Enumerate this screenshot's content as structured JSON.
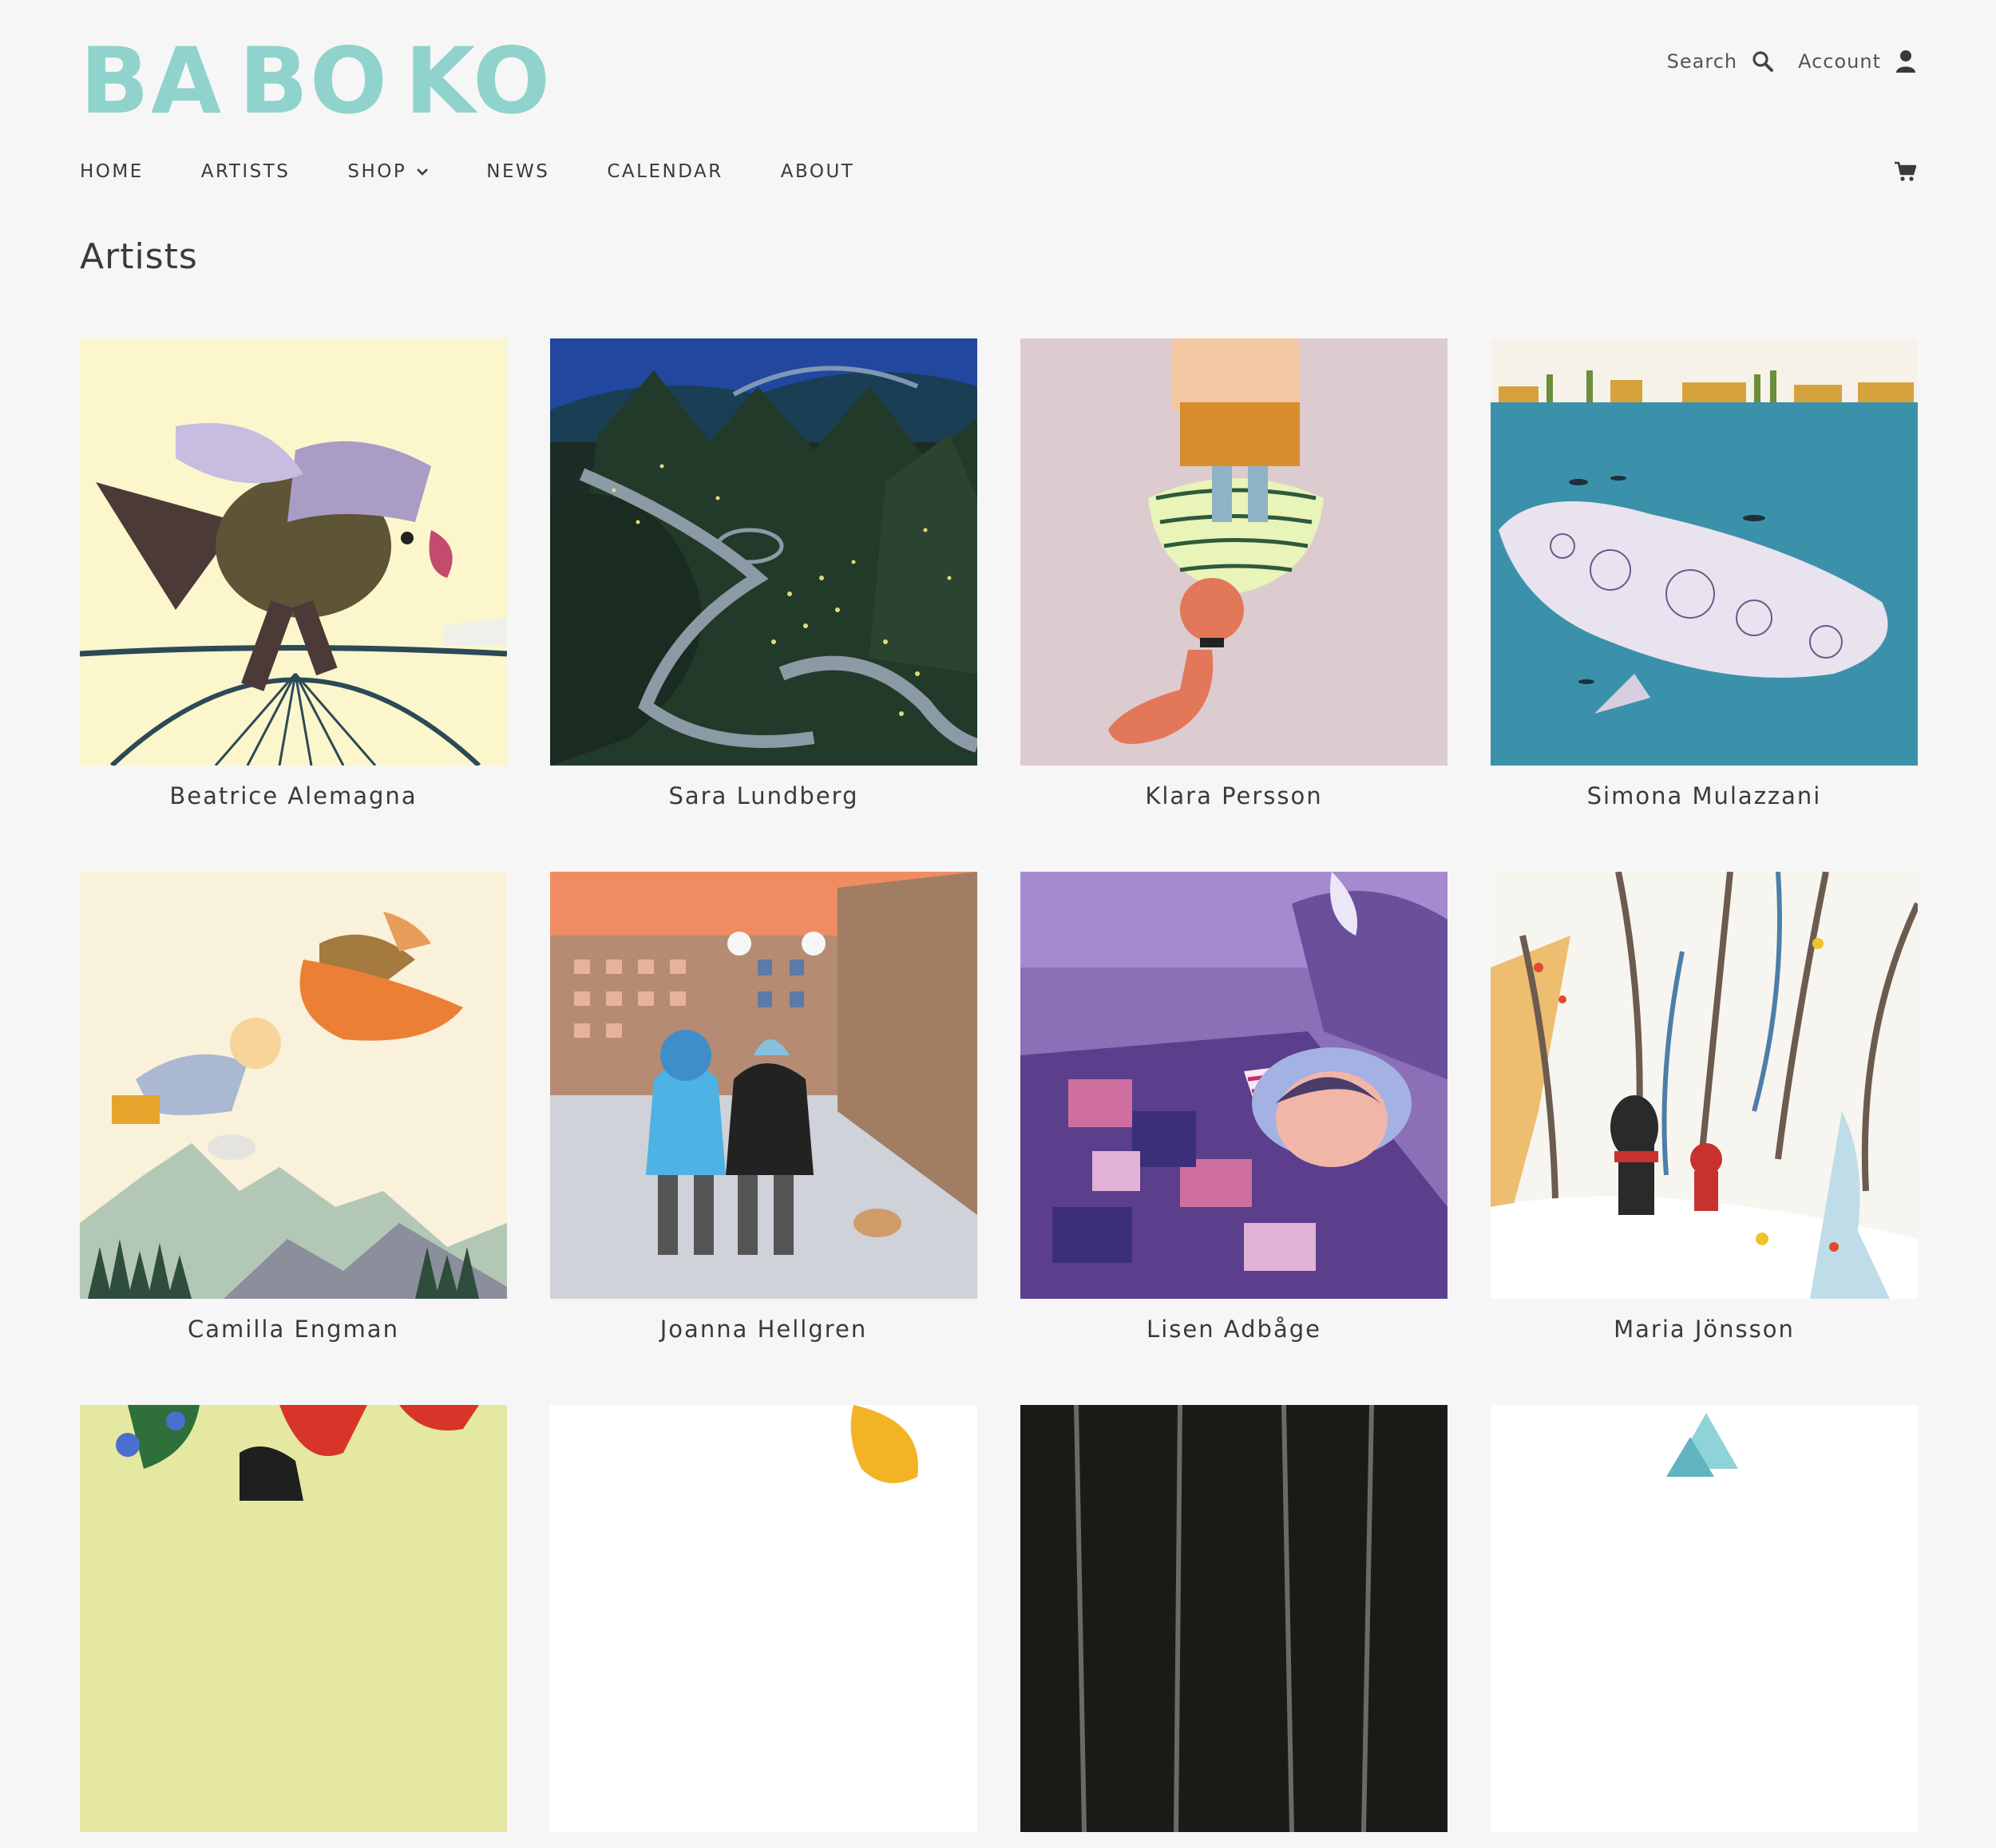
{
  "brand": {
    "logo_parts": [
      "BA",
      "BO",
      "KO"
    ],
    "color": "#8fd3cc"
  },
  "header": {
    "search_label": "Search",
    "account_label": "Account"
  },
  "nav": {
    "items": [
      "HOME",
      "ARTISTS",
      "SHOP",
      "NEWS",
      "CALENDAR",
      "ABOUT"
    ]
  },
  "page": {
    "title": "Artists"
  },
  "artists": [
    {
      "name": "Beatrice Alemagna"
    },
    {
      "name": "Sara Lundberg"
    },
    {
      "name": "Klara Persson"
    },
    {
      "name": "Simona Mulazzani"
    },
    {
      "name": "Camilla Engman"
    },
    {
      "name": "Joanna Hellgren"
    },
    {
      "name": "Lisen Adbåge"
    },
    {
      "name": "Maria Jönsson"
    },
    {
      "name": ""
    },
    {
      "name": ""
    },
    {
      "name": ""
    },
    {
      "name": ""
    }
  ]
}
